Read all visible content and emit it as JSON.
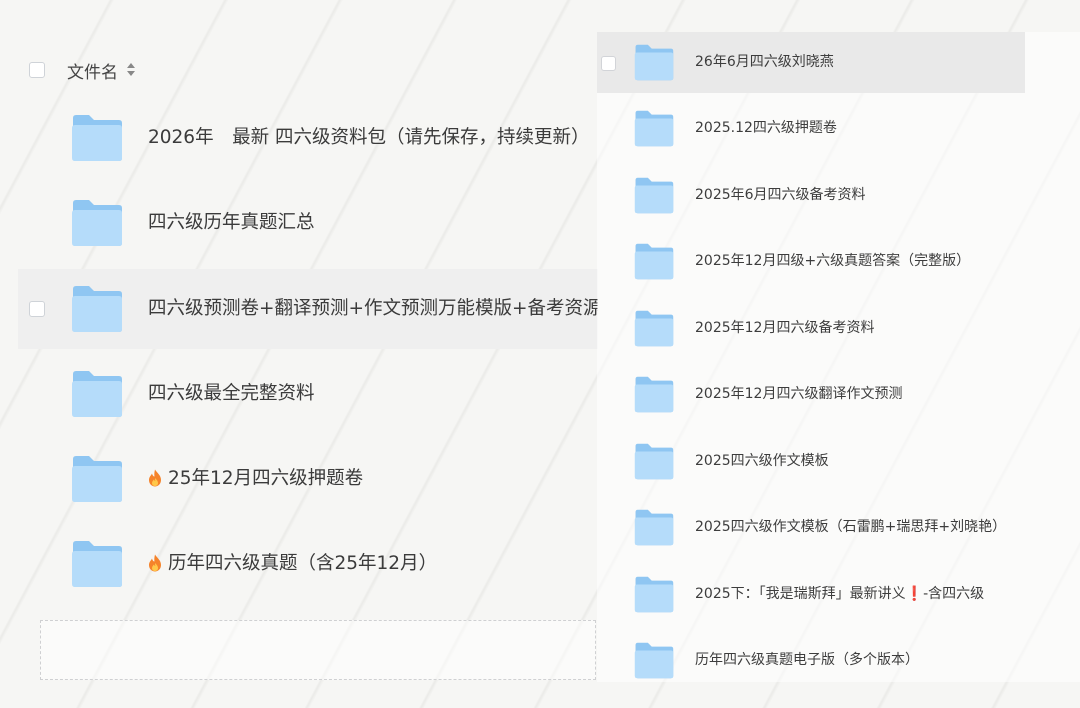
{
  "left_list": {
    "header": {
      "column_label": "文件名"
    },
    "rows": [
      {
        "name": "2026年　最新  四六级资料包（请先保存，持续更新）",
        "fire": false
      },
      {
        "name": "四六级历年真题汇总",
        "fire": false
      },
      {
        "name": "四六级预测卷+翻译预测+作文预测万能模版+备考资源",
        "fire": false,
        "selected": true
      },
      {
        "name": "四六级最全完整资料",
        "fire": false
      },
      {
        "name": "25年12月四六级押题卷",
        "fire": true
      },
      {
        "name": "历年四六级真题（含25年12月）",
        "fire": true
      }
    ]
  },
  "right_list": {
    "rows": [
      {
        "name": "26年6月四六级刘晓燕",
        "selected": true
      },
      {
        "name": "2025.12四六级押题卷"
      },
      {
        "name": "2025年6月四六级备考资料"
      },
      {
        "name": "2025年12月四级+六级真题答案（完整版）"
      },
      {
        "name": "2025年12月四六级备考资料"
      },
      {
        "name": "2025年12月四六级翻译作文预测"
      },
      {
        "name": "2025四六级作文模板"
      },
      {
        "name": "2025四六级作文模板（石雷鹏+瑞思拜+刘晓艳）"
      },
      {
        "name_before": "2025下：「我是瑞斯拜」最新讲义",
        "exclaim": "❗",
        "name_after": "-含四六级"
      },
      {
        "name": "历年四六级真题电子版（多个版本）"
      }
    ]
  },
  "colors": {
    "folder_back": "#8fc6f2",
    "folder_front": "#b5dcfa",
    "selected_row": "#efefef",
    "exclaim": "#e0312e"
  }
}
